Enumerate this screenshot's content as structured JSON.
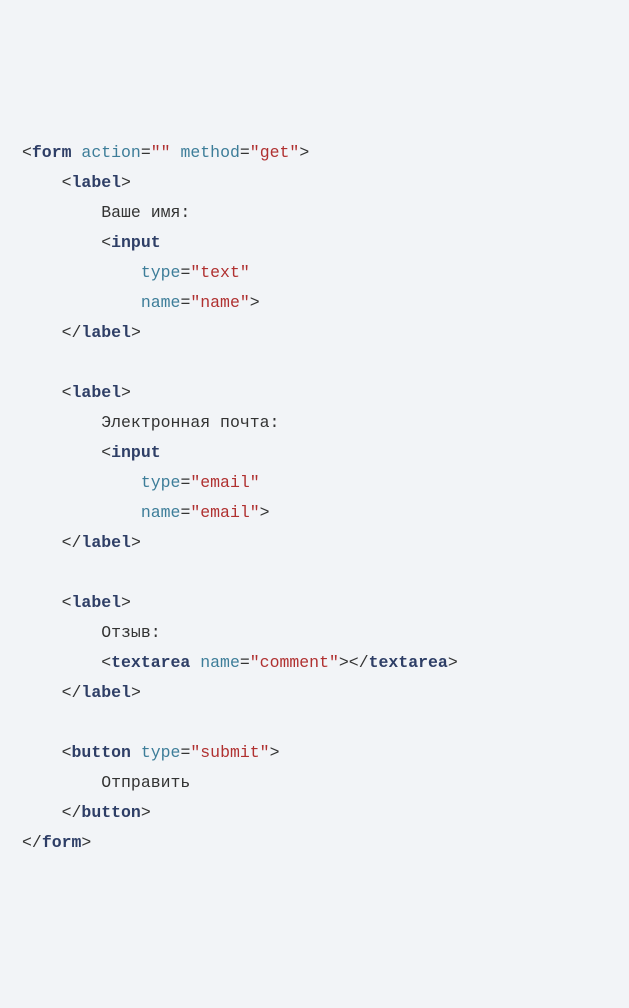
{
  "form": {
    "tag_open": "form",
    "action_attr": "action",
    "action_val": "\"\"",
    "method_attr": "method",
    "method_val": "\"get\"",
    "tag_close": "form"
  },
  "label_open": "label",
  "label_close": "label",
  "input_tag": "input",
  "type_attr": "type",
  "name_attr": "name",
  "name_label_text": "Ваше имя:",
  "name_type_val": "\"text\"",
  "name_name_val": "\"name\"",
  "email_label_text": "Электронная почта:",
  "email_type_val": "\"email\"",
  "email_name_val": "\"email\"",
  "comment_label_text": "Отзыв:",
  "textarea_tag": "textarea",
  "comment_name_val": "\"comment\"",
  "button_tag": "button",
  "button_type_val": "\"submit\"",
  "button_text": "Отправить"
}
